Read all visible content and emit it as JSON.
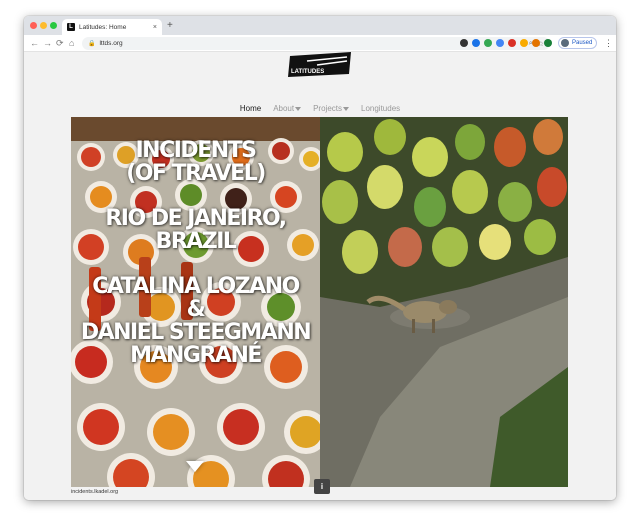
{
  "browser": {
    "tab_title": "Latitudes: Home",
    "tab_close": "×",
    "new_tab": "+",
    "url": "lttds.org",
    "back": "←",
    "forward": "→",
    "reload": "⟳",
    "home": "⌂",
    "profile_status": "Paused",
    "menu": "⋮",
    "favicon_letter": "L"
  },
  "site": {
    "logo_text": "LATITUDES",
    "nav": {
      "home": "Home",
      "about": "About",
      "projects": "Projects",
      "longitudes": "Longitudes"
    },
    "hero": {
      "line1": "INCIDENTS",
      "line2": "(OF TRAVEL)",
      "line3": "RIO DE JANEIRO,",
      "line4": "BRAZIL",
      "line5": "CATALINA LOZANO",
      "line6": "&",
      "line7": "DANIEL STEEGMANN",
      "line8": "MANGRANÉ"
    },
    "footer_link": "incidents.lkadel.org",
    "info_icon": "i"
  }
}
